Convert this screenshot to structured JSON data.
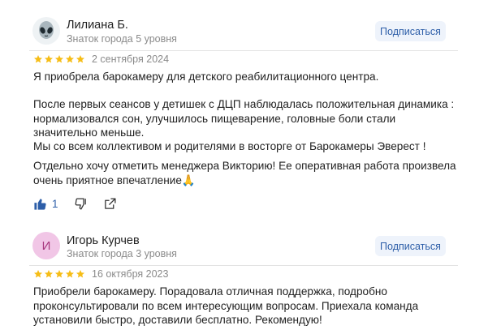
{
  "reviews": [
    {
      "author": "Лилиана Б.",
      "level": "Знаток города 5 уровня",
      "avatar_icon": "alien-emoji-icon",
      "subscribe_label": "Подписаться",
      "rating": 5,
      "date": "2 сентября 2024",
      "paragraphs": [
        "Я приобрела барокамеру для детского реабилитационного центра.",
        "После первых сеансов у детишек с ДЦП наблюдалась положительная динамика : нормализовался сон, улучшилось пищеварение, головные боли стали значительно меньше.",
        "Мы со всем коллективом и родителями в восторге от Барокамеры Эверест !",
        "Отдельно хочу отметить менеджера Викторию! Ее оперативная работа произвела очень приятное впечатление🙏"
      ],
      "likes": "1"
    },
    {
      "author": "Игорь Курчев",
      "level": "Знаток города 3 уровня",
      "avatar_letter": "И",
      "subscribe_label": "Подписаться",
      "rating": 5,
      "date": "16 октября 2023",
      "paragraphs": [
        "Приобрели барокамеру. Порадовала отличная поддержка, подробно проконсультировали по всем интересующим вопросам. Приехала команда установили быстро, доставили бесплатно. Рекомендую!"
      ]
    }
  ],
  "colors": {
    "star": "#f6bd16",
    "accent": "#2d5ea8",
    "subscribe_bg": "#eef3fb",
    "avatar_letter_bg": "#f1c6e6"
  }
}
